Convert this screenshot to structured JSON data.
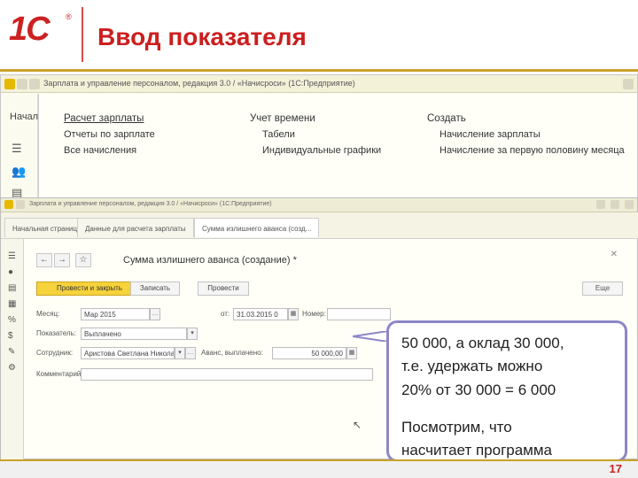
{
  "slide": {
    "title": "Ввод показателя",
    "page_number": "17",
    "logo_text": "1С",
    "logo_mark": "®",
    "colors": {
      "title_red": "#cc1f1f",
      "accent_gold": "#c9a227",
      "callout_border": "#8d86c8",
      "primary_button": "#f6d23b"
    }
  },
  "back_window": {
    "title": "Зарплата и управление персоналом, редакция 3.0 / «Начисроси» (1С:Предприятие)",
    "home_tab": "Начал",
    "columns": [
      {
        "head": "Расчет зарплаты",
        "items": [
          "Отчеты по зарплате",
          "Все начисления"
        ]
      },
      {
        "head": "Учет времени",
        "items": [
          "Табели",
          "Индивидуальные графики"
        ]
      },
      {
        "head": "Создать",
        "items": [
          "Начисление зарплаты",
          "Начисление за первую половину месяца"
        ]
      }
    ]
  },
  "front_window": {
    "title": "Зарплата и управление персоналом, редакция 3.0 / «Начисроси» (1С:Предприятие)",
    "tabs": [
      "Начальная страница",
      "Данные для расчета зарплаты",
      "Сумма излишнего аванса (созд..."
    ],
    "form_title": "Сумма излишнего аванса (создание) *",
    "buttons": {
      "post_close": "Провести и закрыть",
      "save": "Записать",
      "post": "Провести",
      "more": "Еще"
    },
    "fields": {
      "month_label": "Месяц:",
      "month_value": "Мар 2015",
      "date_label": "от:",
      "date_value": "31.03.2015 0",
      "number_label": "Номер:",
      "indicator_label": "Показатель:",
      "indicator_value": "Выплачено",
      "employee_label": "Сотрудник:",
      "employee_value": "Аристова Светлана Николаевна",
      "amount_label": "Аванс, выплачено:",
      "amount_value": "50 000,00",
      "comment_label": "Комментарий:"
    }
  },
  "callout": {
    "line1": "50 000, а оклад 30 000,",
    "line2": "т.е. удержать можно",
    "line3": "20% от 30 000 = 6 000",
    "line4": "Посмотрим, что",
    "line5": "насчитает программа"
  }
}
